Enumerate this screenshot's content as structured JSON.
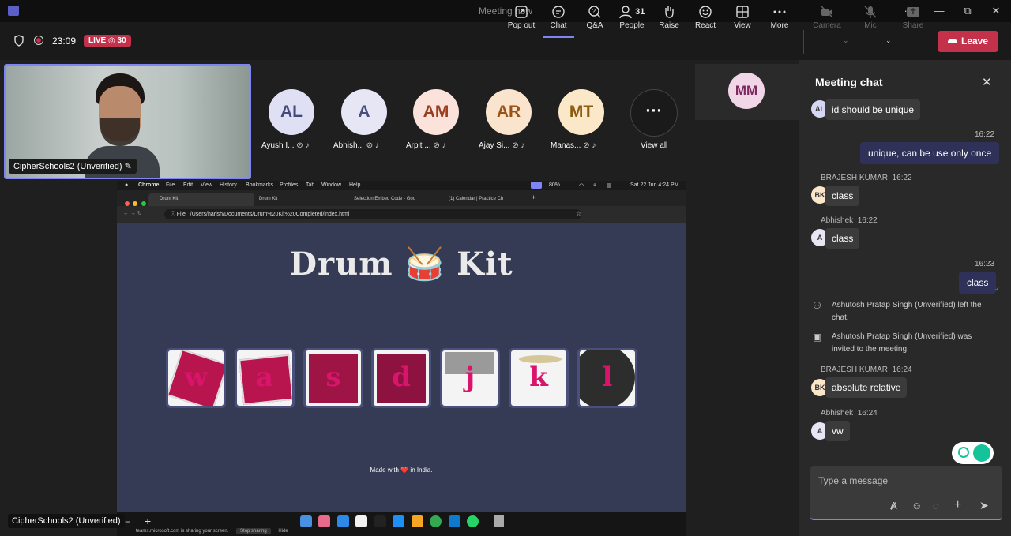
{
  "window": {
    "title": "Meeting now",
    "dots": "···",
    "minimize": "—",
    "restore": "⧉",
    "close": "✕"
  },
  "meeting": {
    "timer": "23:09",
    "live_label": "LIVE",
    "viewers": "30",
    "toolbar": {
      "popout": "Pop out",
      "chat": "Chat",
      "qa": "Q&A",
      "people": "People",
      "people_count": "31",
      "raise": "Raise",
      "react": "React",
      "view": "View",
      "more": "More",
      "camera": "Camera",
      "mic": "Mic",
      "share": "Share",
      "leave": "Leave"
    }
  },
  "selfview": {
    "name": "CipherSchools2 (Unverified)"
  },
  "participants": [
    {
      "initials": "AL",
      "name": "Ayush I...",
      "bg": "#e0e0f4",
      "fg": "#444a7a"
    },
    {
      "initials": "A",
      "name": "Abhish...",
      "bg": "#e6e6f5",
      "fg": "#4a4f7e"
    },
    {
      "initials": "AM",
      "name": "Arpit ...",
      "bg": "#fbe3dc",
      "fg": "#9b3e1e"
    },
    {
      "initials": "AR",
      "name": "Ajay Si...",
      "bg": "#fbe4cd",
      "fg": "#9a5216"
    },
    {
      "initials": "MT",
      "name": "Manas...",
      "bg": "#fbe8c8",
      "fg": "#8a5b10"
    }
  ],
  "view_all": "View all",
  "mm_tile": {
    "initials": "MM"
  },
  "screenshare": {
    "mac_menu": [
      "Chrome",
      "File",
      "Edit",
      "View",
      "History",
      "Bookmarks",
      "Profiles",
      "Tab",
      "Window",
      "Help"
    ],
    "mac_clock": "Sat 22 Jun  4:24 PM",
    "battery": "80%",
    "tabs": [
      "Drum Kit",
      "Drum Kit",
      "Selection Embed Code - Goo",
      "(1) Calendar | Practice Ch"
    ],
    "url_prefix": "File",
    "url": "/Users/harish/Documents/Drum%20Kit%20Completed/index.html",
    "page_title": "Drum 🥁 Kit",
    "keys": [
      "w",
      "a",
      "s",
      "d",
      "j",
      "k",
      "l"
    ],
    "made_with": "Made with ❤️ in India.",
    "sharing_text": "teams.microsoft.com is sharing your screen.",
    "stop_sharing": "Stop sharing",
    "hide": "Hide"
  },
  "presenter_chip": "CipherSchools2 (Unverified)",
  "chat": {
    "title": "Meeting chat",
    "messages": [
      {
        "type": "in",
        "initials": "AL",
        "text": "id should be unique"
      },
      {
        "type": "out",
        "time": "16:22",
        "text": "unique, can be use only once"
      },
      {
        "type": "in",
        "sender": "BRAJESH KUMAR",
        "time": "16:22",
        "initials": "BK",
        "text": "class"
      },
      {
        "type": "in",
        "sender": "Abhishek",
        "time": "16:22",
        "initials": "A",
        "text": "class"
      },
      {
        "type": "out",
        "time": "16:23",
        "text": "class"
      },
      {
        "type": "sys",
        "text": "Ashutosh Pratap Singh (Unverified) left the chat."
      },
      {
        "type": "sys",
        "text": "Ashutosh Pratap Singh (Unverified) was invited to the meeting."
      },
      {
        "type": "in",
        "sender": "BRAJESH KUMAR",
        "time": "16:24",
        "initials": "BK",
        "text": "absolute relative"
      },
      {
        "type": "in",
        "sender": "Abhishek",
        "time": "16:24",
        "initials": "A",
        "text": "vw"
      }
    ],
    "input_placeholder": "Type a message"
  },
  "colors": {
    "accent": "#7f85f5",
    "leave": "#c4314b",
    "drum": "#d8156b"
  }
}
